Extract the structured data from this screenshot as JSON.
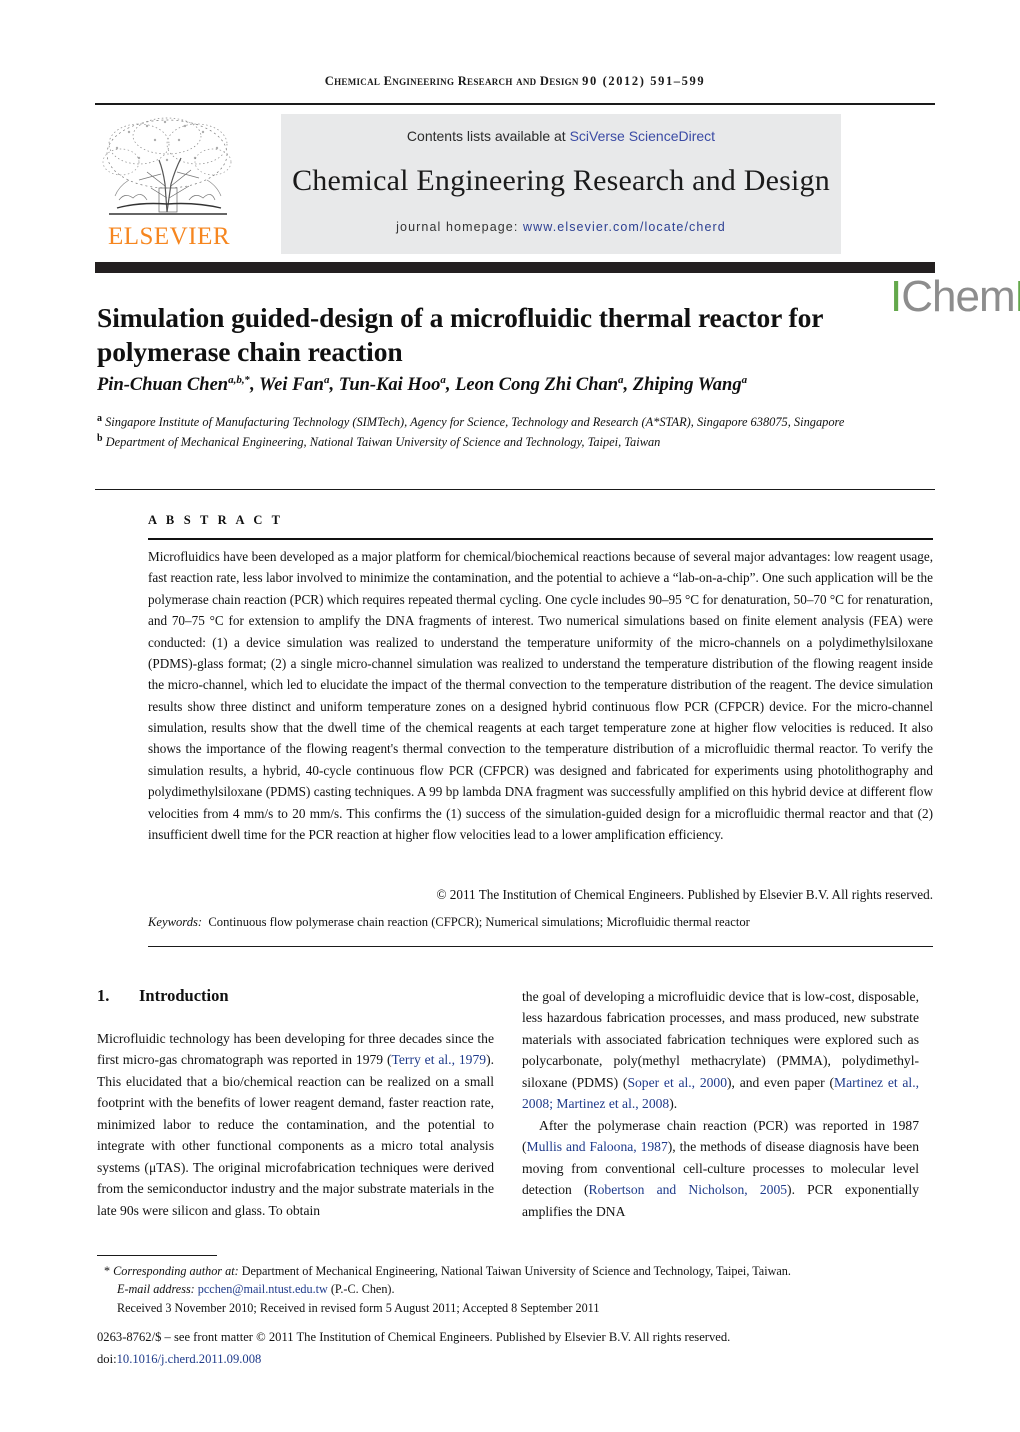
{
  "running_head": {
    "journal": "Chemical Engineering Research and Design",
    "volume_year_pages": "90 (2012) 591–599"
  },
  "masthead": {
    "elsevier_wordmark": "ELSEVIER",
    "contents_prefix": "Contents lists available at ",
    "contents_link": "SciVerse ScienceDirect",
    "journal_title": "Chemical Engineering Research and Design",
    "homepage_prefix": "journal homepage: ",
    "homepage_url": "www.elsevier.com/locate/cherd",
    "icheme_part1": "I",
    "icheme_part2": "Chem",
    "icheme_part3": "E",
    "accent_orange": "#F6861F",
    "accent_green": "#63a84b",
    "accent_grey": "#8d8d8d",
    "link_blue": "#3b4ba5"
  },
  "article": {
    "title": "Simulation guided-design of a microfluidic thermal reactor for polymerase chain reaction",
    "authors_html": "Pin-Chuan Chen<sup>a,b,</sup><sup class=\"star\">*</sup>, Wei Fan<sup>a</sup>, Tun-Kai Hoo<sup>a</sup>, Leon Cong Zhi Chan<sup>a</sup>, Zhiping Wang<sup>a</sup>",
    "affiliation_a": "Singapore Institute of Manufacturing Technology (SIMTech), Agency for Science, Technology and Research (A*STAR), Singapore 638075, Singapore",
    "affiliation_b": "Department of Mechanical Engineering, National Taiwan University of Science and Technology, Taipei, Taiwan"
  },
  "abstract": {
    "label": "A B S T R A C T",
    "text": "Microfluidics have been developed as a major platform for chemical/biochemical reactions because of several major advantages: low reagent usage, fast reaction rate, less labor involved to minimize the contamination, and the potential to achieve a “lab-on-a-chip”. One such application will be the polymerase chain reaction (PCR) which requires repeated thermal cycling. One cycle includes 90–95 °C for denaturation, 50–70 °C for renaturation, and 70–75 °C for extension to amplify the DNA fragments of interest. Two numerical simulations based on finite element analysis (FEA) were conducted: (1) a device simulation was realized to understand the temperature uniformity of the micro-channels on a polydimethylsiloxane (PDMS)-glass format; (2) a single micro-channel simulation was realized to understand the temperature distribution of the flowing reagent inside the micro-channel, which led to elucidate the impact of the thermal convection to the temperature distribution of the reagent. The device simulation results show three distinct and uniform temperature zones on a designed hybrid continuous flow PCR (CFPCR) device. For the micro-channel simulation, results show that the dwell time of the chemical reagents at each target temperature zone at higher flow velocities is reduced. It also shows the importance of the flowing reagent's thermal convection to the temperature distribution of a microfluidic thermal reactor. To verify the simulation results, a hybrid, 40-cycle continuous flow PCR (CFPCR) was designed and fabricated for experiments using photolithography and polydimethylsiloxane (PDMS) casting techniques. A 99 bp lambda DNA fragment was successfully amplified on this hybrid device at different flow velocities from 4 mm/s to 20 mm/s. This confirms the (1) success of the simulation-guided design for a microfluidic thermal reactor and that (2) insufficient dwell time for the PCR reaction at higher flow velocities lead to a lower amplification efficiency.",
    "copyright": "© 2011 The Institution of Chemical Engineers. Published by Elsevier B.V. All rights reserved.",
    "keywords_label": "Keywords:",
    "keywords_value": "Continuous flow polymerase chain reaction (CFPCR); Numerical simulations; Microfluidic thermal reactor"
  },
  "body": {
    "section_number": "1.",
    "section_title": "Introduction",
    "left_paragraph_html": "Microfluidic technology has been developing for three decades since the first micro-gas chromatograph was reported in 1979 (<span class=\"ref\">Terry et al., 1979</span>). This elucidated that a bio/chemical reaction can be realized on a small footprint with the benefits of lower reagent demand, faster reaction rate, minimized labor to reduce the contamination, and the potential to integrate with other functional components as a micro total analysis systems (μTAS). The original microfabrication techniques were derived from the semiconductor industry and the major substrate materials in the late 90s were silicon and glass. To obtain",
    "right_paragraph_1_html": "the goal of developing a microfluidic device that is low-cost, disposable, less hazardous fabrication processes, and mass produced, new substrate materials with associated fabrication techniques were explored such as polycarbonate, poly(methyl methacrylate) (PMMA), polydimethyl-siloxane (PDMS) (<span class=\"ref\">Soper et al., 2000</span>), and even paper (<span class=\"ref\">Martinez et al., 2008; Martinez et al., 2008</span>).",
    "right_paragraph_2_html": "After the polymerase chain reaction (PCR) was reported in 1987 (<span class=\"ref\">Mullis and Faloona, 1987</span>), the methods of disease diagnosis have been moving from conventional cell-culture processes to molecular level detection (<span class=\"ref\">Robertson and Nicholson, 2005</span>). PCR exponentially amplifies the DNA"
  },
  "footer": {
    "corresponding_label": "Corresponding author at:",
    "corresponding_text": " Department of Mechanical Engineering, National Taiwan University of Science and Technology, Taipei, Taiwan.",
    "email_label": "E-mail address:",
    "email_address": "pcchen@mail.ntust.edu.tw",
    "email_suffix": " (P.-C. Chen).",
    "history": "Received 3 November 2010; Received in revised form 5 August 2011; Accepted 8 September 2011",
    "issn_line": "0263-8762/$ – see front matter © 2011 The Institution of Chemical Engineers. Published by Elsevier B.V. All rights reserved.",
    "doi_label": "doi:",
    "doi_value": "10.1016/j.cherd.2011.09.008"
  }
}
